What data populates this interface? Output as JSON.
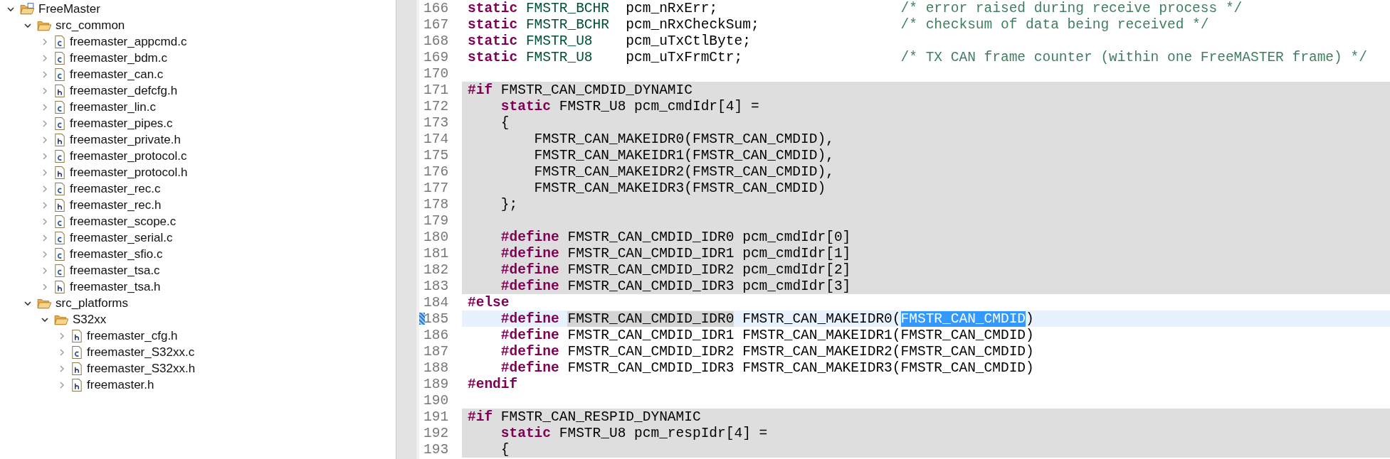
{
  "project_tree": {
    "items": [
      {
        "label": "FreeMaster",
        "kind": "project",
        "expanded": true,
        "children": [
          {
            "label": "src_common",
            "kind": "folder",
            "expanded": true,
            "children": [
              {
                "label": "freemaster_appcmd.c",
                "kind": "c",
                "expanded": false
              },
              {
                "label": "freemaster_bdm.c",
                "kind": "c",
                "expanded": false
              },
              {
                "label": "freemaster_can.c",
                "kind": "c",
                "expanded": false
              },
              {
                "label": "freemaster_defcfg.h",
                "kind": "h",
                "expanded": false
              },
              {
                "label": "freemaster_lin.c",
                "kind": "c",
                "expanded": false
              },
              {
                "label": "freemaster_pipes.c",
                "kind": "c",
                "expanded": false
              },
              {
                "label": "freemaster_private.h",
                "kind": "h",
                "expanded": false
              },
              {
                "label": "freemaster_protocol.c",
                "kind": "c",
                "expanded": false
              },
              {
                "label": "freemaster_protocol.h",
                "kind": "h",
                "expanded": false
              },
              {
                "label": "freemaster_rec.c",
                "kind": "c",
                "expanded": false
              },
              {
                "label": "freemaster_rec.h",
                "kind": "h",
                "expanded": false
              },
              {
                "label": "freemaster_scope.c",
                "kind": "c",
                "expanded": false
              },
              {
                "label": "freemaster_serial.c",
                "kind": "c",
                "expanded": false
              },
              {
                "label": "freemaster_sfio.c",
                "kind": "c",
                "expanded": false
              },
              {
                "label": "freemaster_tsa.c",
                "kind": "c",
                "expanded": false
              },
              {
                "label": "freemaster_tsa.h",
                "kind": "h",
                "expanded": false
              }
            ]
          },
          {
            "label": "src_platforms",
            "kind": "folder",
            "expanded": true,
            "children": [
              {
                "label": "S32xx",
                "kind": "folder",
                "expanded": true,
                "children": [
                  {
                    "label": "freemaster_cfg.h",
                    "kind": "h",
                    "expanded": false
                  },
                  {
                    "label": "freemaster_S32xx.c",
                    "kind": "c",
                    "expanded": false
                  },
                  {
                    "label": "freemaster_S32xx.h",
                    "kind": "h",
                    "expanded": false
                  },
                  {
                    "label": "freemaster.h",
                    "kind": "h",
                    "expanded": false
                  }
                ]
              }
            ]
          }
        ]
      }
    ]
  },
  "editor": {
    "lines": [
      {
        "number": "166",
        "shaded": false,
        "current": false,
        "tokens": [
          {
            "kind": "keyword",
            "text": "static"
          },
          {
            "kind": "type",
            "text": " FMSTR_BCHR"
          },
          {
            "kind": "plain",
            "text": "  pcm_nRxErr;                      "
          },
          {
            "kind": "comment",
            "text": "/* error raised during receive process */"
          }
        ]
      },
      {
        "number": "167",
        "shaded": false,
        "current": false,
        "tokens": [
          {
            "kind": "keyword",
            "text": "static"
          },
          {
            "kind": "type",
            "text": " FMSTR_BCHR"
          },
          {
            "kind": "plain",
            "text": "  pcm_nRxCheckSum;                 "
          },
          {
            "kind": "comment",
            "text": "/* checksum of data being received */"
          }
        ]
      },
      {
        "number": "168",
        "shaded": false,
        "current": false,
        "tokens": [
          {
            "kind": "keyword",
            "text": "static"
          },
          {
            "kind": "type",
            "text": " FMSTR_U8"
          },
          {
            "kind": "plain",
            "text": "    pcm_uTxCtlByte;"
          }
        ]
      },
      {
        "number": "169",
        "shaded": false,
        "current": false,
        "tokens": [
          {
            "kind": "keyword",
            "text": "static"
          },
          {
            "kind": "type",
            "text": " FMSTR_U8"
          },
          {
            "kind": "plain",
            "text": "    pcm_uTxFrmCtr;                   "
          },
          {
            "kind": "comment",
            "text": "/* TX CAN frame counter (within one FreeMASTER frame) */"
          }
        ]
      },
      {
        "number": "170",
        "shaded": false,
        "current": false
      },
      {
        "number": "171",
        "shaded": true,
        "current": false,
        "tokens": [
          {
            "kind": "keyword",
            "text": "#if"
          },
          {
            "kind": "plain",
            "text": " FMSTR_CAN_CMDID_DYNAMIC"
          }
        ]
      },
      {
        "number": "172",
        "shaded": true,
        "current": false,
        "tokens": [
          {
            "kind": "keyword",
            "text": "    static"
          },
          {
            "kind": "plain",
            "text": " FMSTR_U8 pcm_cmdIdr[4] ="
          }
        ]
      },
      {
        "number": "173",
        "shaded": true,
        "current": false,
        "tokens": [
          {
            "kind": "plain",
            "text": "    {"
          }
        ]
      },
      {
        "number": "174",
        "shaded": true,
        "current": false,
        "tokens": [
          {
            "kind": "plain",
            "text": "        FMSTR_CAN_MAKEIDR0(FMSTR_CAN_CMDID),"
          }
        ]
      },
      {
        "number": "175",
        "shaded": true,
        "current": false,
        "tokens": [
          {
            "kind": "plain",
            "text": "        FMSTR_CAN_MAKEIDR1(FMSTR_CAN_CMDID),"
          }
        ]
      },
      {
        "number": "176",
        "shaded": true,
        "current": false,
        "tokens": [
          {
            "kind": "plain",
            "text": "        FMSTR_CAN_MAKEIDR2(FMSTR_CAN_CMDID),"
          }
        ]
      },
      {
        "number": "177",
        "shaded": true,
        "current": false,
        "tokens": [
          {
            "kind": "plain",
            "text": "        FMSTR_CAN_MAKEIDR3(FMSTR_CAN_CMDID)"
          }
        ]
      },
      {
        "number": "178",
        "shaded": true,
        "current": false,
        "tokens": [
          {
            "kind": "plain",
            "text": "    };"
          }
        ]
      },
      {
        "number": "179",
        "shaded": true,
        "current": false
      },
      {
        "number": "180",
        "shaded": true,
        "current": false,
        "tokens": [
          {
            "kind": "keyword",
            "text": "    #define"
          },
          {
            "kind": "plain",
            "text": " FMSTR_CAN_CMDID_IDR0 pcm_cmdIdr[0]"
          }
        ]
      },
      {
        "number": "181",
        "shaded": true,
        "current": false,
        "tokens": [
          {
            "kind": "keyword",
            "text": "    #define"
          },
          {
            "kind": "plain",
            "text": " FMSTR_CAN_CMDID_IDR1 pcm_cmdIdr[1]"
          }
        ]
      },
      {
        "number": "182",
        "shaded": true,
        "current": false,
        "tokens": [
          {
            "kind": "keyword",
            "text": "    #define"
          },
          {
            "kind": "plain",
            "text": " FMSTR_CAN_CMDID_IDR2 pcm_cmdIdr[2]"
          }
        ]
      },
      {
        "number": "183",
        "shaded": true,
        "current": false,
        "tokens": [
          {
            "kind": "keyword",
            "text": "    #define"
          },
          {
            "kind": "plain",
            "text": " FMSTR_CAN_CMDID_IDR3 pcm_cmdIdr[3]"
          }
        ]
      },
      {
        "number": "184",
        "shaded": false,
        "current": false,
        "tokens": [
          {
            "kind": "keyword",
            "text": "#else"
          }
        ]
      },
      {
        "number": "185",
        "shaded": false,
        "current": true,
        "tokens": [
          {
            "kind": "keyword",
            "text": "    #define "
          },
          {
            "kind": "occurrence",
            "text": "FMSTR_CAN_CMDID_IDR0"
          },
          {
            "kind": "plain",
            "text": " FMSTR_CAN_MAKEIDR0("
          },
          {
            "kind": "selection",
            "text": "FMSTR_CAN_CMDID"
          },
          {
            "kind": "plain",
            "text": ")"
          }
        ]
      },
      {
        "number": "186",
        "shaded": false,
        "current": false,
        "tokens": [
          {
            "kind": "keyword",
            "text": "    #define"
          },
          {
            "kind": "plain",
            "text": " FMSTR_CAN_CMDID_IDR1 FMSTR_CAN_MAKEIDR1(FMSTR_CAN_CMDID)"
          }
        ]
      },
      {
        "number": "187",
        "shaded": false,
        "current": false,
        "tokens": [
          {
            "kind": "keyword",
            "text": "    #define"
          },
          {
            "kind": "plain",
            "text": " FMSTR_CAN_CMDID_IDR2 FMSTR_CAN_MAKEIDR2(FMSTR_CAN_CMDID)"
          }
        ]
      },
      {
        "number": "188",
        "shaded": false,
        "current": false,
        "tokens": [
          {
            "kind": "keyword",
            "text": "    #define"
          },
          {
            "kind": "plain",
            "text": " FMSTR_CAN_CMDID_IDR3 FMSTR_CAN_MAKEIDR3(FMSTR_CAN_CMDID)"
          }
        ]
      },
      {
        "number": "189",
        "shaded": false,
        "current": false,
        "tokens": [
          {
            "kind": "keyword",
            "text": "#endif"
          }
        ]
      },
      {
        "number": "190",
        "shaded": false,
        "current": false
      },
      {
        "number": "191",
        "shaded": true,
        "current": false,
        "tokens": [
          {
            "kind": "keyword",
            "text": "#if"
          },
          {
            "kind": "plain",
            "text": " FMSTR_CAN_RESPID_DYNAMIC"
          }
        ]
      },
      {
        "number": "192",
        "shaded": true,
        "current": false,
        "tokens": [
          {
            "kind": "keyword",
            "text": "    static"
          },
          {
            "kind": "plain",
            "text": " FMSTR_U8 pcm_respIdr[4] ="
          }
        ]
      },
      {
        "number": "193",
        "shaded": true,
        "current": false,
        "tokens": [
          {
            "kind": "plain",
            "text": "    {"
          }
        ]
      }
    ]
  }
}
